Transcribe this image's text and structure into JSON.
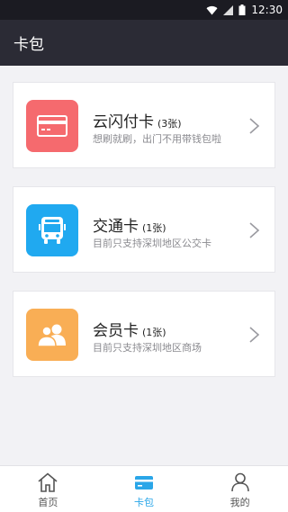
{
  "status_bar": {
    "time": "12:30",
    "icons": [
      "wifi-icon",
      "signal-icon",
      "battery-icon"
    ]
  },
  "header": {
    "title": "卡包"
  },
  "cards": [
    {
      "title": "云闪付卡",
      "count": "(3张)",
      "subtitle": "想刷就刷，出门不用带钱包啦",
      "icon": "credit-card-icon",
      "color": "#f56a6e"
    },
    {
      "title": "交通卡",
      "count": "(1张)",
      "subtitle": "目前只支持深圳地区公交卡",
      "icon": "bus-icon",
      "color": "#20a9f0"
    },
    {
      "title": "会员卡",
      "count": "(1张)",
      "subtitle": "目前只支持深圳地区商场",
      "icon": "members-icon",
      "color": "#f9ae55"
    }
  ],
  "tabs": [
    {
      "label": "首页",
      "icon": "home-icon"
    },
    {
      "label": "卡包",
      "icon": "wallet-icon",
      "active": true
    },
    {
      "label": "我的",
      "icon": "user-icon"
    }
  ],
  "colors": {
    "accent": "#2aa6e8",
    "header_bg": "#2b2b35"
  }
}
